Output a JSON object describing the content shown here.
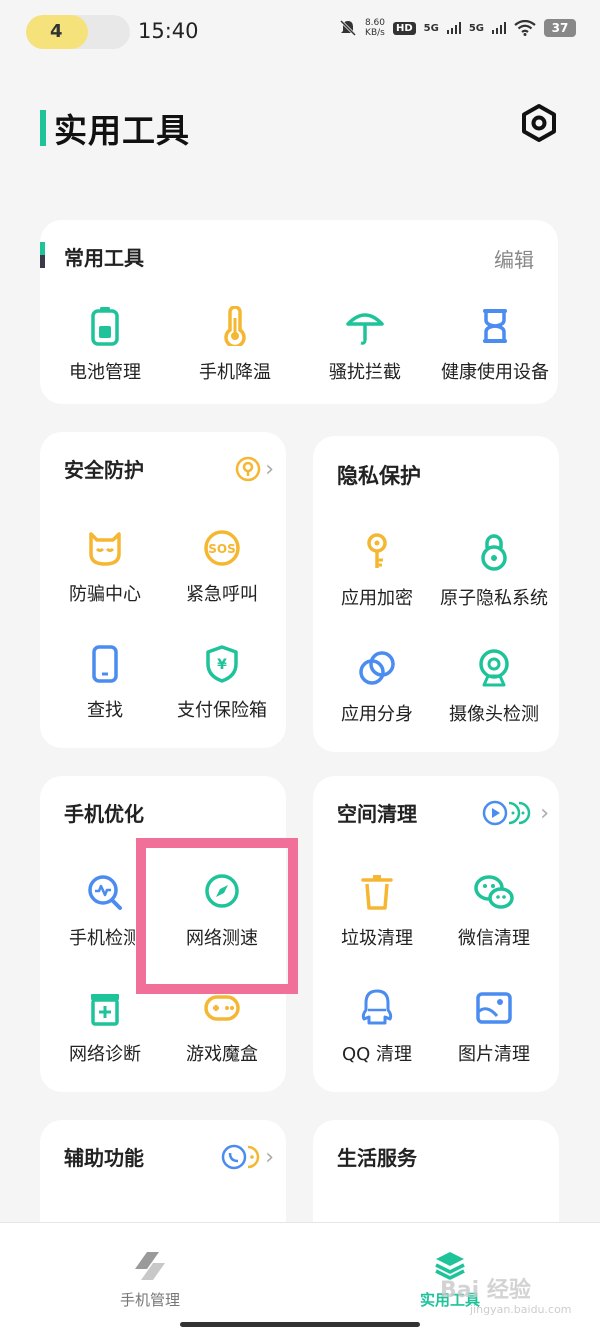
{
  "status_bar": {
    "pill_value": "4",
    "time": "15:40",
    "net_speed_value": "8.60",
    "net_speed_unit": "KB/s",
    "hd": "HD",
    "signal1": "5G",
    "signal2": "5G",
    "battery": "37"
  },
  "page": {
    "title": "实用工具"
  },
  "common_tools": {
    "title": "常用工具",
    "edit_label": "编辑",
    "items": [
      {
        "label": "电池管理",
        "icon": "battery-icon"
      },
      {
        "label": "手机降温",
        "icon": "thermometer-icon"
      },
      {
        "label": "骚扰拦截",
        "icon": "umbrella-icon"
      },
      {
        "label": "健康使用设备",
        "icon": "hourglass-icon"
      }
    ]
  },
  "security": {
    "title": "安全防护",
    "items": [
      {
        "label": "防骗中心",
        "icon": "mask-icon"
      },
      {
        "label": "紧急呼叫",
        "icon": "sos-icon"
      },
      {
        "label": "查找",
        "icon": "phone-icon"
      },
      {
        "label": "支付保险箱",
        "icon": "shield-yen-icon"
      }
    ]
  },
  "privacy": {
    "title": "隐私保护",
    "items": [
      {
        "label": "应用加密",
        "icon": "key-icon"
      },
      {
        "label": "原子隐私系统",
        "icon": "lock-icon"
      },
      {
        "label": "应用分身",
        "icon": "clone-icon"
      },
      {
        "label": "摄像头检测",
        "icon": "camera-icon"
      }
    ]
  },
  "optimize": {
    "title": "手机优化",
    "items": [
      {
        "label": "手机检测",
        "icon": "scan-icon"
      },
      {
        "label": "网络测速",
        "icon": "compass-icon"
      },
      {
        "label": "网络诊断",
        "icon": "medkit-icon"
      },
      {
        "label": "游戏魔盒",
        "icon": "gamepad-icon"
      }
    ]
  },
  "storage": {
    "title": "空间清理",
    "items": [
      {
        "label": "垃圾清理",
        "icon": "trash-icon"
      },
      {
        "label": "微信清理",
        "icon": "wechat-icon"
      },
      {
        "label": "QQ 清理",
        "icon": "qq-icon"
      },
      {
        "label": "图片清理",
        "icon": "picture-icon"
      }
    ]
  },
  "assist": {
    "title": "辅助功能"
  },
  "life": {
    "title": "生活服务"
  },
  "bottom_nav": {
    "left_label": "手机管理",
    "right_label": "实用工具"
  },
  "watermark": {
    "text": "Bai 经验",
    "sub": "jingyan.baidu.com"
  },
  "colors": {
    "accent": "#1fc39a",
    "orange": "#f5b731",
    "blue": "#4a8cf0",
    "highlight": "#f0709a"
  }
}
